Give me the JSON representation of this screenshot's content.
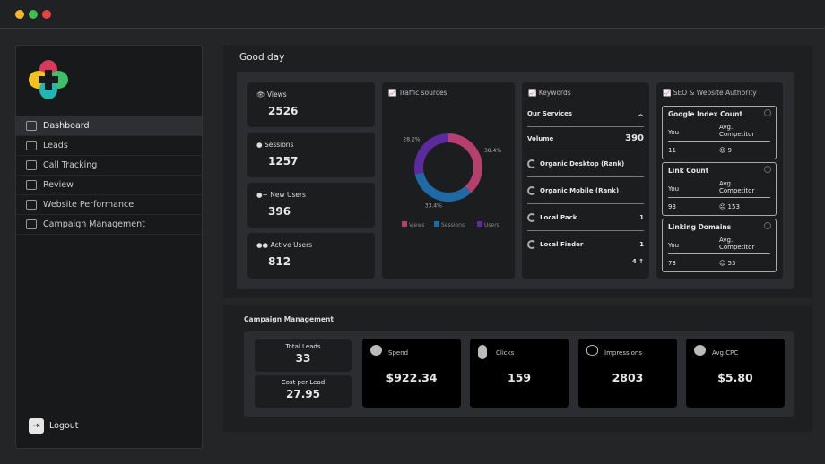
{
  "window": {
    "controls": [
      "close",
      "minimize",
      "maximize"
    ]
  },
  "sidebar": {
    "items": [
      {
        "label": "Dashboard",
        "icon": "dashboard-icon",
        "active": true
      },
      {
        "label": "Leads",
        "icon": "leads-icon"
      },
      {
        "label": "Call Tracking",
        "icon": "phone-icon"
      },
      {
        "label": "Review",
        "icon": "star-icon"
      },
      {
        "label": "Website Performance",
        "icon": "gear-icon"
      },
      {
        "label": "Campaign Management",
        "icon": "campaign-icon"
      }
    ],
    "logout": "Logout"
  },
  "greeting": "Good day",
  "stats": [
    {
      "label": "Views",
      "value": "2526",
      "icon": "eye-icon"
    },
    {
      "label": "Sessions",
      "value": "1257",
      "icon": "user-icon"
    },
    {
      "label": "New Users",
      "value": "396",
      "icon": "user-plus-icon"
    },
    {
      "label": "Active Users",
      "value": "812",
      "icon": "users-icon"
    }
  ],
  "traffic": {
    "title": "Traffic sources"
  },
  "chart_data": {
    "type": "pie",
    "donut": true,
    "categories": [
      "Views",
      "Sessions",
      "Users"
    ],
    "values": [
      38.4,
      33.4,
      28.2
    ],
    "labels": [
      "38.4%",
      "33.4%",
      "28.2%"
    ],
    "colors": [
      "#b5406f",
      "#1f6aa5",
      "#5b2a9c"
    ],
    "legend": "bottom"
  },
  "keywords": {
    "title": "Keywords",
    "section": "Our Services",
    "volume_label": "Volume",
    "volume": "390",
    "rows": [
      {
        "label": "Organic Desktop (Rank)",
        "value": ""
      },
      {
        "label": "Organic Mobile (Rank)",
        "value": ""
      },
      {
        "label": "Local Pack",
        "value": "1"
      },
      {
        "label": "Local Finder",
        "value": "1"
      }
    ],
    "footer": "4 ↑"
  },
  "seo": {
    "title": "SEO & Website Authority",
    "you_label": "You",
    "avg_label": "Avg.",
    "competitor_label": "Competitor",
    "cards": [
      {
        "title": "Google Index Count",
        "you": "11",
        "competitor": "9",
        "face": "☺"
      },
      {
        "title": "Link Count",
        "you": "93",
        "competitor": "153",
        "face": "☹"
      },
      {
        "title": "Linking Domains",
        "you": "73",
        "competitor": "53",
        "face": "☺"
      }
    ]
  },
  "campaign": {
    "title": "Campaign Management",
    "total_leads_label": "Total Leads",
    "total_leads": "33",
    "cpl_label": "Cost per Lead",
    "cpl": "27.95",
    "metrics": [
      {
        "label": "Spend",
        "value": "$922.34",
        "icon": "money-icon"
      },
      {
        "label": "Clicks",
        "value": "159",
        "icon": "mouse-icon"
      },
      {
        "label": "Impressions",
        "value": "2803",
        "icon": "eye-icon"
      },
      {
        "label": "Avg.CPC",
        "value": "$5.80",
        "icon": "coin-icon"
      }
    ]
  }
}
